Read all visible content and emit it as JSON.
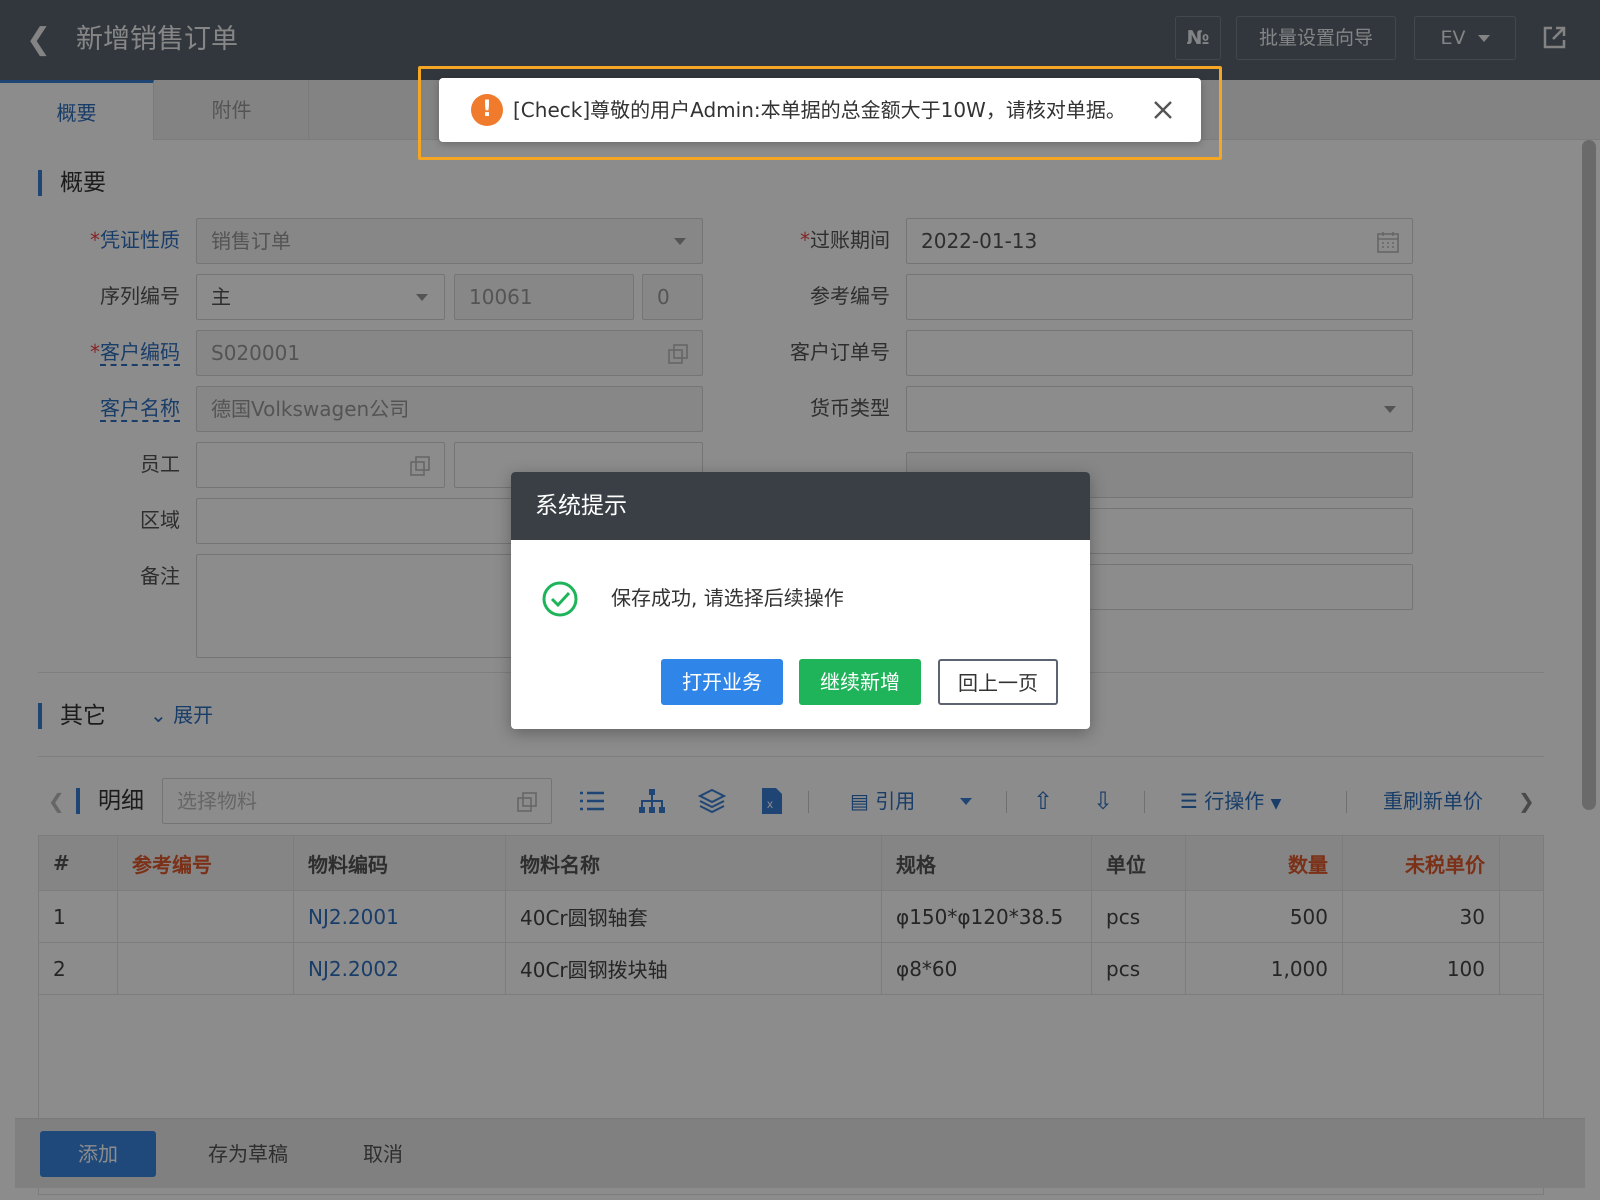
{
  "header": {
    "title": "新增销售订单",
    "no_label": "№",
    "wizard_label": "批量设置向导",
    "ev_label": "EV"
  },
  "tabs": [
    {
      "label": "概要",
      "active": true
    },
    {
      "label": "附件",
      "active": false
    }
  ],
  "summary": {
    "section_title": "概要",
    "left": [
      {
        "label": "凭证性质",
        "value": "销售订单"
      },
      {
        "label": "序列编号",
        "series": "主",
        "number": "10061",
        "extra": "0"
      },
      {
        "label": "客户编码",
        "value": "S020001"
      },
      {
        "label": "客户名称",
        "value": "德国Volkswagen公司"
      },
      {
        "label": "员工",
        "value": ""
      },
      {
        "label": "区域",
        "value": ""
      },
      {
        "label": "备注",
        "value": ""
      }
    ],
    "right": [
      {
        "label": "过账期间",
        "value": "2022-01-13"
      },
      {
        "label": "参考编号",
        "value": ""
      },
      {
        "label": "客户订单号",
        "value": ""
      },
      {
        "label": "货币类型",
        "value": ""
      }
    ]
  },
  "other": {
    "section_title": "其它",
    "expand_label": "展开"
  },
  "detail": {
    "title": "明细",
    "material_placeholder": "选择物料",
    "cite_label": "引用",
    "row_ops_label": "行操作",
    "refresh_price_label": "重刷新单价",
    "columns": [
      "#",
      "参考编号",
      "物料编码",
      "物料名称",
      "规格",
      "单位",
      "数量",
      "未税单价"
    ],
    "rows": [
      {
        "idx": "1",
        "ref": "",
        "code": "NJ2.2001",
        "name": "40Cr圆钢轴套",
        "spec": "φ150*φ120*38.5",
        "unit": "pcs",
        "qty": "500",
        "price": "30"
      },
      {
        "idx": "2",
        "ref": "",
        "code": "NJ2.2002",
        "name": "40Cr圆钢拨块轴",
        "spec": "φ8*60",
        "unit": "pcs",
        "qty": "1,000",
        "price": "100"
      }
    ]
  },
  "footer": {
    "add_label": "添加",
    "draft_label": "存为草稿",
    "cancel_label": "取消"
  },
  "toast": {
    "icon": "!",
    "message": "[Check]尊敬的用户Admin:本单据的总金额大于10W，请核对单据。"
  },
  "dialog": {
    "title": "系统提示",
    "message": "保存成功, 请选择后续操作",
    "open_label": "打开业务",
    "continue_label": "继续新增",
    "back_label": "回上一页"
  },
  "colors": {
    "accent": "#3a86e0",
    "success": "#1fb45a",
    "warning": "#f07b2d",
    "highlight": "#f5a623"
  }
}
